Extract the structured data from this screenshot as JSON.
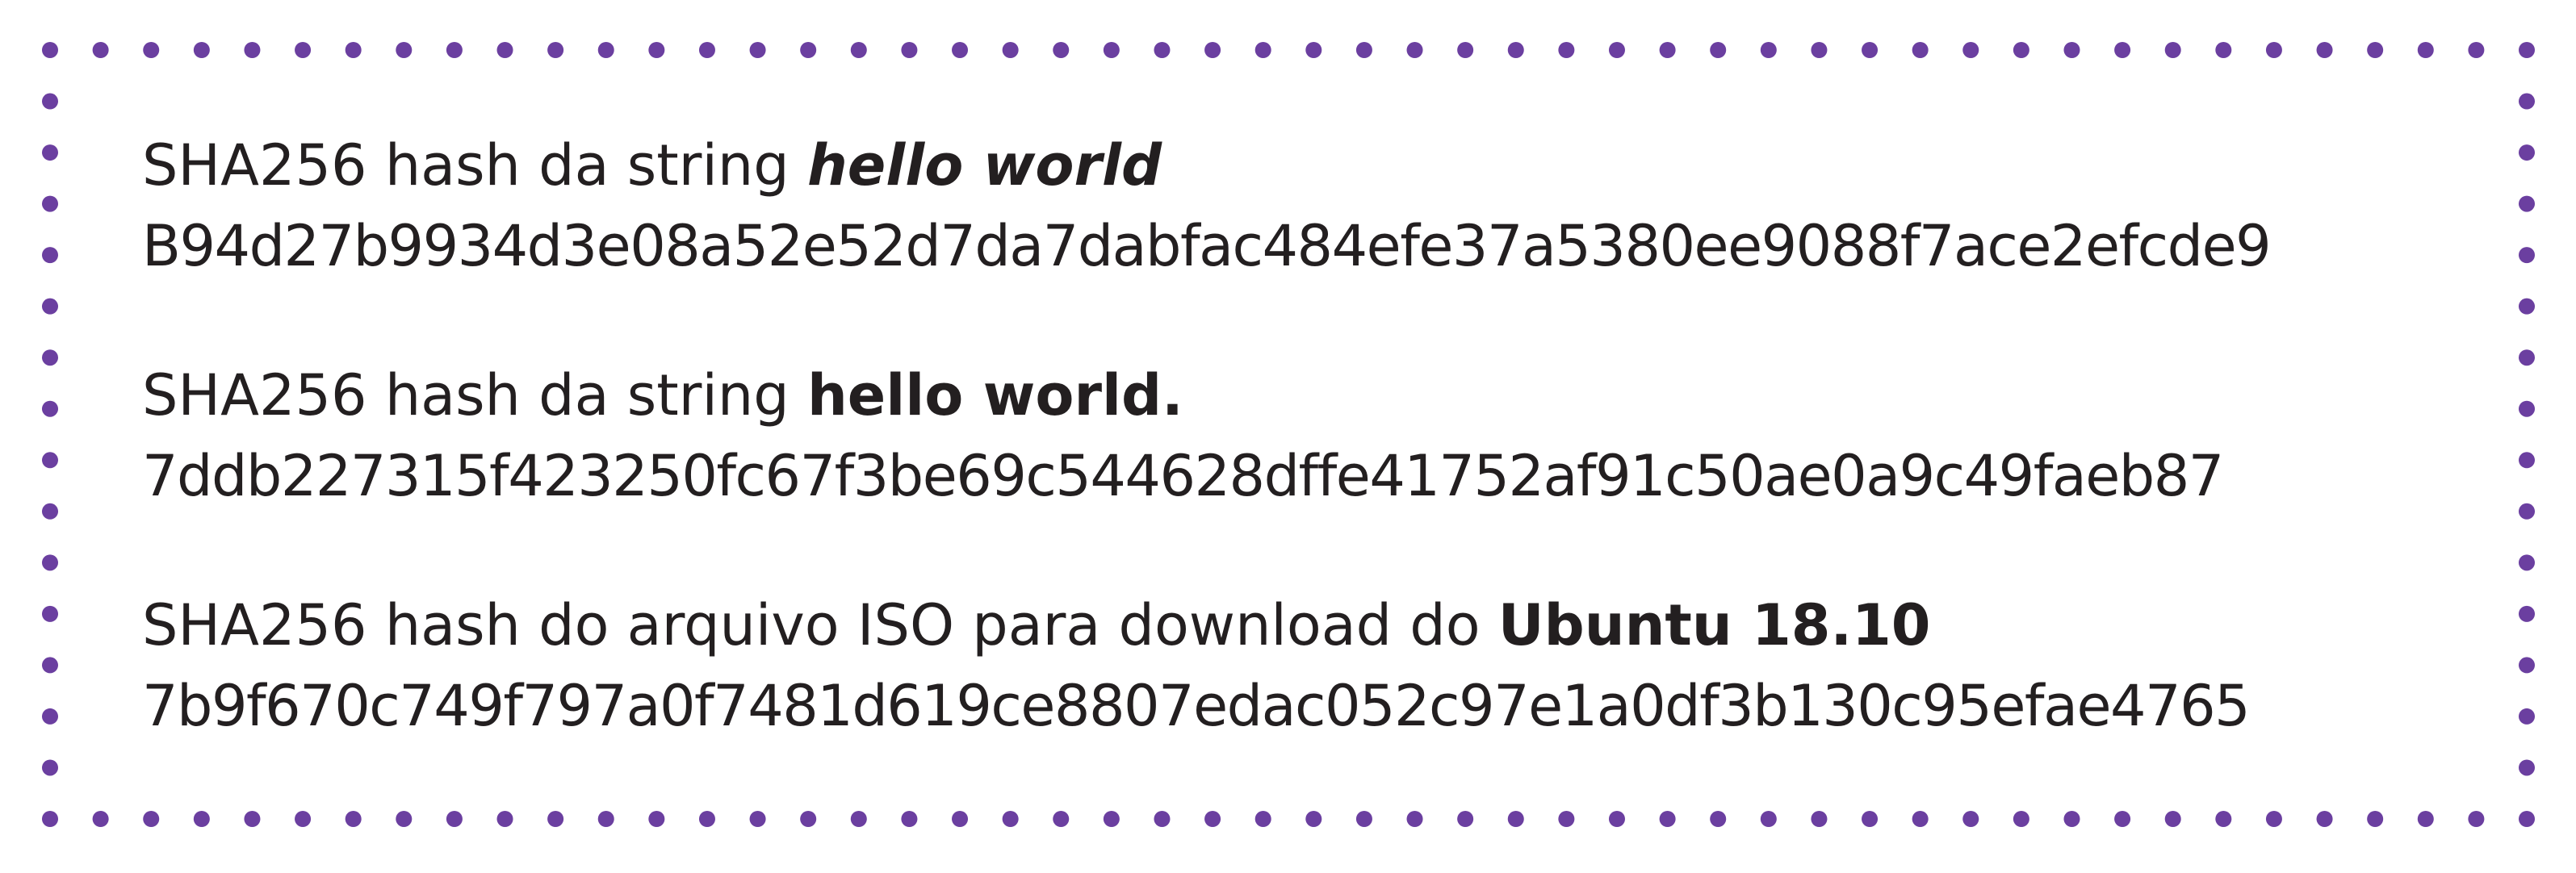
{
  "border": {
    "color": "#6b3fa0",
    "style": "dotted"
  },
  "hashes": [
    {
      "label": "SHA256 hash da string ",
      "subject": "hello world",
      "digest": "B94d27b9934d3e08a52e52d7da7dabfac484efe37a5380ee9088f7ace2efcde9"
    },
    {
      "label": "SHA256 hash da string ",
      "subject": "hello world.",
      "digest": "7ddb227315f423250fc67f3be69c544628dffe41752af91c50ae0a9c49faeb87"
    },
    {
      "label": "SHA256 hash do arquivo ISO para download do ",
      "subject": "Ubuntu 18.10",
      "digest": "7b9f670c749f797a0f7481d619ce8807edac052c97e1a0df3b130c95efae4765"
    }
  ]
}
